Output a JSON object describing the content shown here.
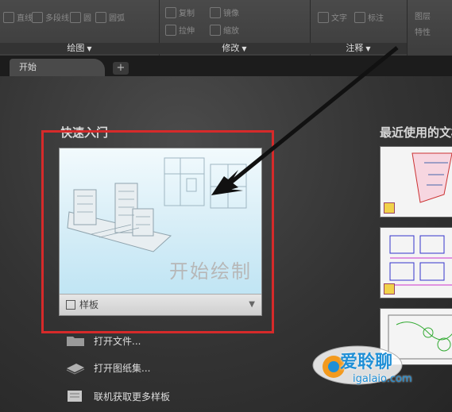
{
  "ribbon": {
    "groups": [
      {
        "label": "绘图",
        "items": [
          "直线",
          "多段线",
          "圆",
          "圆弧"
        ]
      },
      {
        "label": "修改",
        "items": [
          "复制",
          "镜像",
          "拉伸",
          "缩放"
        ]
      },
      {
        "label": "注释",
        "items": [
          "文字",
          "标注"
        ]
      }
    ],
    "right_items": [
      "图层",
      "特性"
    ]
  },
  "tabs": {
    "start_label": "开始",
    "add_label": "+"
  },
  "quick_start": {
    "title": "快速入门",
    "card_label": "开始绘制",
    "template_label": "样板",
    "actions": [
      "打开文件...",
      "打开图纸集...",
      "联机获取更多样板"
    ]
  },
  "recent": {
    "title": "最近使用的文档"
  },
  "watermark": {
    "text": "爱聆聊",
    "url": "igalaio.com"
  },
  "colors": {
    "highlight": "#d62a2a",
    "card_bg": "#d8eef7"
  }
}
